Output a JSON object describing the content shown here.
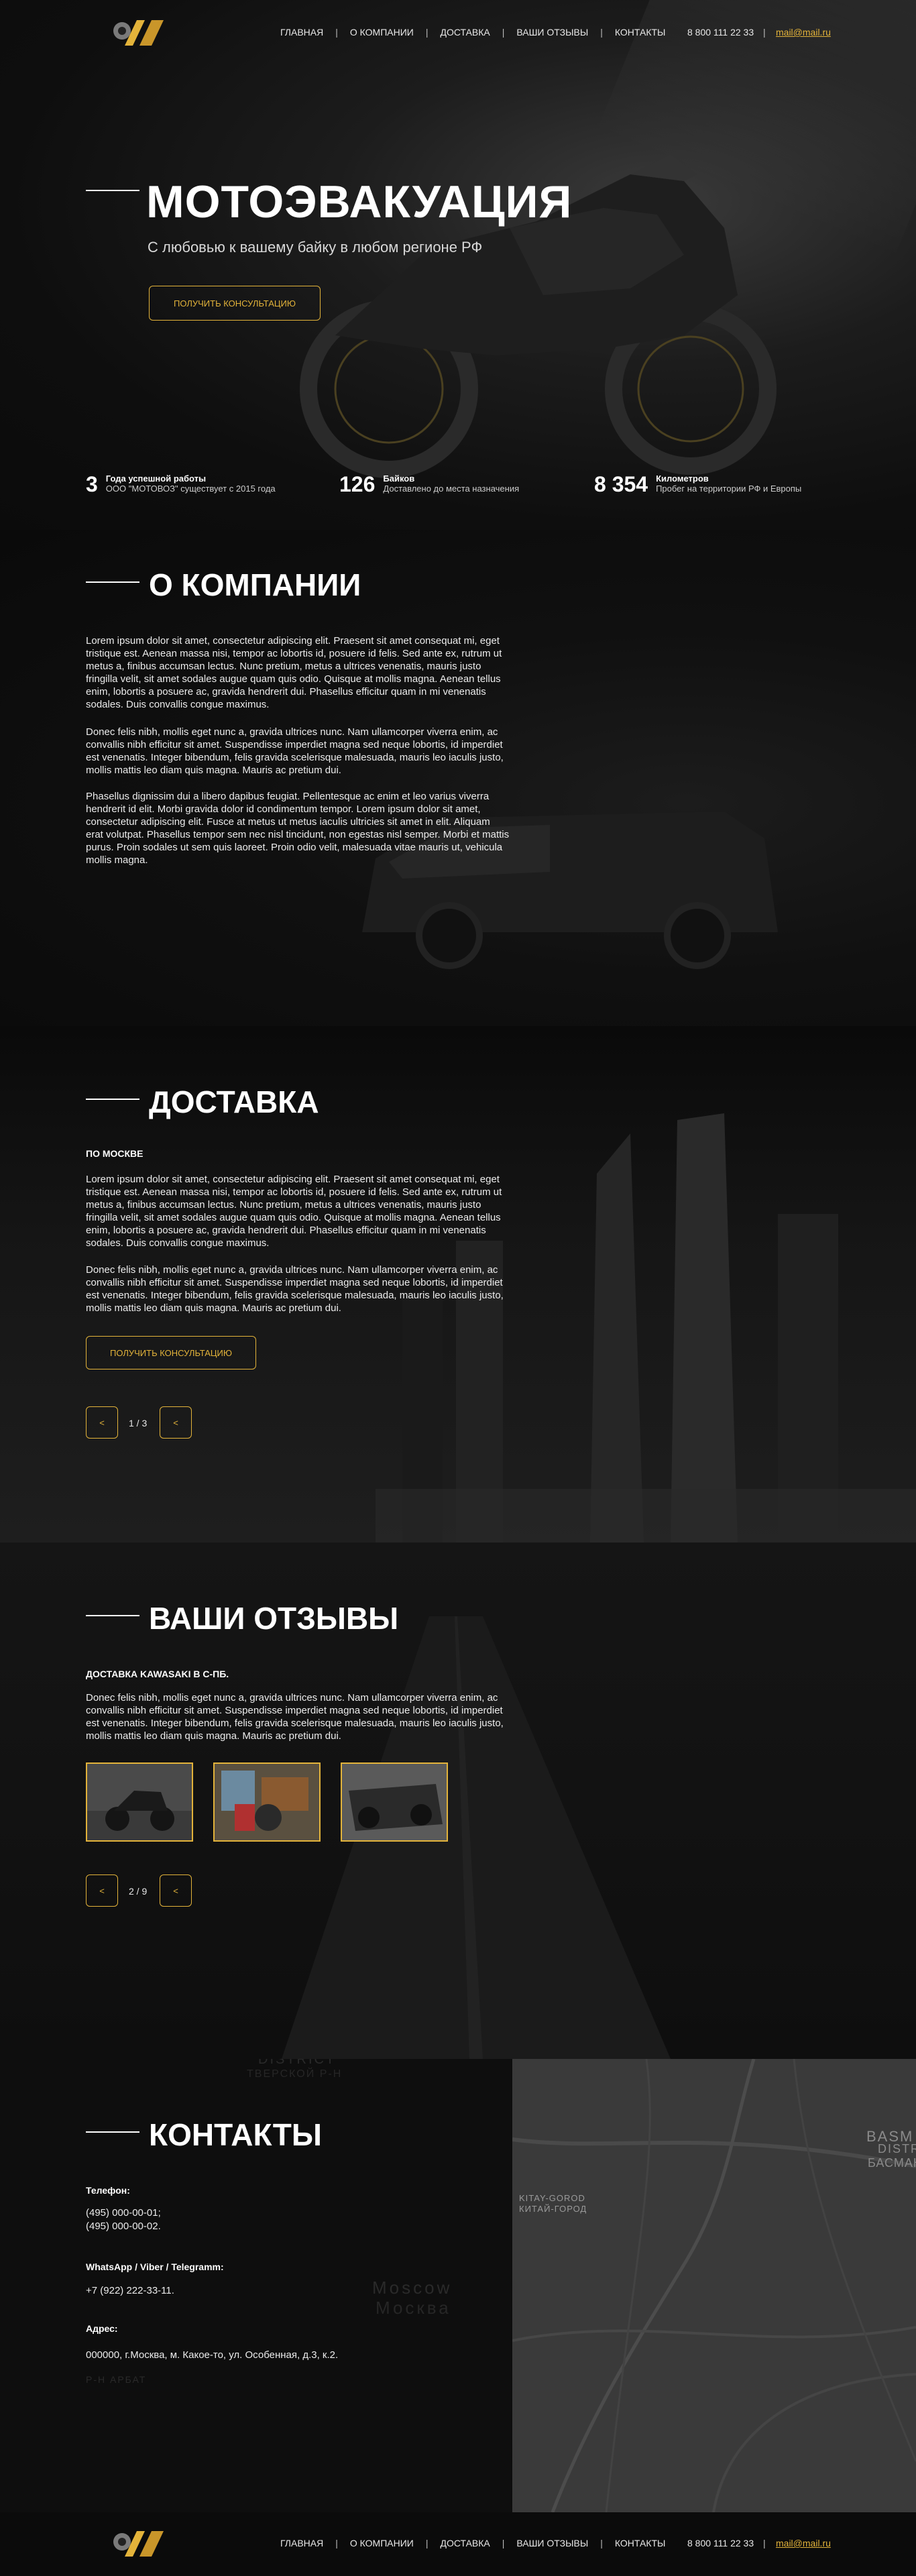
{
  "header": {
    "nav": [
      "ГЛАВНАЯ",
      "О КОМПАНИИ",
      "ДОСТАВКА",
      "ВАШИ ОТЗЫВЫ",
      "КОНТАКТЫ"
    ],
    "separator": "|",
    "phone": "8 800 111 22 33",
    "email": "mail@mail.ru"
  },
  "hero": {
    "title": "МОТОЭВАКУАЦИЯ",
    "subtitle": "С любовью к вашему байку в любом регионе РФ",
    "cta": "ПОЛУЧИТЬ КОНСУЛЬТАЦИЮ",
    "stats": [
      {
        "value": "3",
        "label": "Года успешной работы",
        "text": "ООО \"МОТОВОЗ\" существует с 2015 года"
      },
      {
        "value": "126",
        "label": "Байков",
        "text": "Доставлено до места назначения"
      },
      {
        "value": "8 354",
        "label": "Километров",
        "text": "Пробег на территории РФ и Европы"
      }
    ]
  },
  "about": {
    "title": "О КОМПАНИИ",
    "paragraphs": [
      "Lorem ipsum dolor sit amet, consectetur adipiscing elit. Praesent sit amet consequat mi, eget tristique est. Aenean massa nisi, tempor ac lobortis id, posuere id felis. Sed ante ex, rutrum ut metus a, finibus accumsan lectus. Nunc pretium, metus a ultrices venenatis, mauris justo fringilla velit, sit amet sodales augue quam quis odio. Quisque at mollis magna. Aenean tellus enim, lobortis a posuere ac, gravida hendrerit dui. Phasellus efficitur quam in mi venenatis sodales. Duis convallis congue maximus.",
      "Donec felis nibh, mollis eget nunc a, gravida ultrices nunc. Nam ullamcorper viverra enim, ac convallis nibh efficitur sit amet. Suspendisse imperdiet magna sed neque lobortis, id imperdiet est venenatis. Integer bibendum, felis gravida scelerisque malesuada, mauris leo iaculis justo, mollis mattis leo diam quis magna. Mauris ac pretium dui.",
      "Phasellus dignissim dui a libero dapibus feugiat. Pellentesque ac enim et leo varius viverra hendrerit id elit. Morbi gravida dolor id condimentum tempor. Lorem ipsum dolor sit amet, consectetur adipiscing elit. Fusce at metus ut metus iaculis ultricies sit amet in elit. Aliquam erat volutpat. Phasellus tempor sem nec nisl tincidunt, non egestas nisl semper. Morbi et mattis purus. Proin sodales ut sem quis laoreet. Proin odio velit, malesuada vitae mauris ut, vehicula mollis magna."
    ]
  },
  "delivery": {
    "title": "ДОСТАВКА",
    "subtitle": "ПО МОСКВЕ",
    "paragraphs": [
      "Lorem ipsum dolor sit amet, consectetur adipiscing elit. Praesent sit amet consequat mi, eget tristique est. Aenean massa nisi, tempor ac lobortis id, posuere id felis. Sed ante ex, rutrum ut metus a, finibus accumsan lectus. Nunc pretium, metus a ultrices venenatis, mauris justo fringilla velit, sit amet sodales augue quam quis odio. Quisque at mollis magna. Aenean tellus enim, lobortis a posuere ac, gravida hendrerit dui. Phasellus efficitur quam in mi venenatis sodales. Duis convallis congue maximus.",
      "Donec felis nibh, mollis eget nunc a, gravida ultrices nunc. Nam ullamcorper viverra enim, ac convallis nibh efficitur sit amet. Suspendisse imperdiet magna sed neque lobortis, id imperdiet est venenatis. Integer bibendum, felis gravida scelerisque malesuada, mauris leo iaculis justo, mollis mattis leo diam quis magna. Mauris ac pretium dui."
    ],
    "cta": "ПОЛУЧИТЬ КОНСУЛЬТАЦИЮ",
    "prev": "<",
    "next": "<",
    "counter": "1 / 3"
  },
  "reviews": {
    "title": "ВАШИ ОТЗЫВЫ",
    "subtitle": "ДОСТАВКА KAWASAKI В С-ПБ.",
    "paragraph": "Donec felis nibh, mollis eget nunc a, gravida ultrices nunc. Nam ullamcorper viverra enim, ac convallis nibh efficitur sit amet. Suspendisse imperdiet magna sed neque lobortis, id imperdiet est venenatis. Integer bibendum, felis gravida scelerisque malesuada, mauris leo iaculis justo, mollis mattis leo diam quis magna. Mauris ac pretium dui.",
    "prev": "<",
    "next": "<",
    "counter": "2 / 9"
  },
  "contacts": {
    "title": "КОНТАКТЫ",
    "phone_label": "Телефон:",
    "phone_1": "(495) 000-00-01;",
    "phone_2": "(495) 000-00-02.",
    "messenger_label": "WhatsApp / Viber / Telegramm:",
    "messenger_value": "+7 (922) 222-33-11.",
    "address_label": "Адрес:",
    "address_value": "000000, г.Москва, м. Какое-то, ул. Особенная, д.3, к.2.",
    "map_labels": [
      "DISTRICT",
      "ТВЕРСКОЙ Р-Н",
      "BASM",
      "DISTR",
      "БАСМАН",
      "KITAY-GOROD",
      "КИТАЙ-ГОРОД",
      "Moscow",
      "Москва",
      "Р-Н АРБАТ"
    ]
  },
  "colors": {
    "accent": "#e3b33a",
    "background": "#0b0b0b"
  }
}
